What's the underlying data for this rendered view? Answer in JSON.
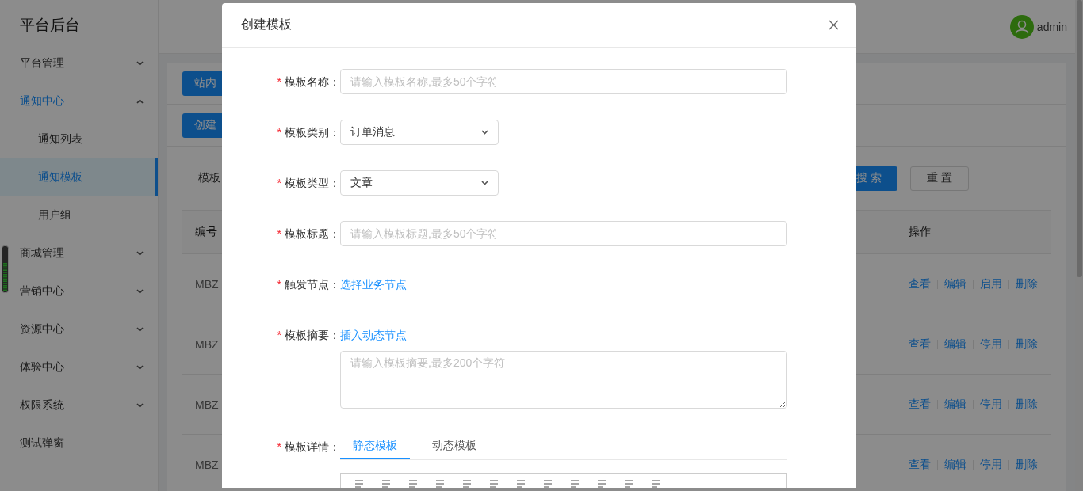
{
  "app": {
    "title": "平台后台"
  },
  "sidebar": {
    "items": [
      {
        "kind": "group",
        "label": "平台管理",
        "expanded": false
      },
      {
        "kind": "group",
        "label": "通知中心",
        "expanded": true,
        "children": [
          {
            "label": "通知列表",
            "selected": false
          },
          {
            "label": "通知模板",
            "selected": true
          },
          {
            "label": "用户组",
            "selected": false
          }
        ]
      },
      {
        "kind": "group",
        "label": "商城管理",
        "expanded": false
      },
      {
        "kind": "group",
        "label": "营销中心",
        "expanded": false
      },
      {
        "kind": "group",
        "label": "资源中心",
        "expanded": false
      },
      {
        "kind": "group",
        "label": "体验中心",
        "expanded": false
      },
      {
        "kind": "group",
        "label": "权限系统",
        "expanded": false
      },
      {
        "kind": "link",
        "label": "测试弹窗"
      }
    ]
  },
  "header": {
    "user": "admin"
  },
  "page": {
    "tab_button": "站内",
    "create_button": "创建",
    "filter_label": "模板",
    "search_button": "搜索",
    "reset_button": "重置"
  },
  "table": {
    "columns": [
      "编号",
      "操作"
    ],
    "rows": [
      {
        "id": "MBZ",
        "actions": [
          "查看",
          "编辑",
          "启用",
          "删除"
        ]
      },
      {
        "id": "MBZ",
        "actions": [
          "查看",
          "编辑",
          "停用",
          "删除"
        ]
      },
      {
        "id": "MBZ",
        "actions": [
          "查看",
          "编辑",
          "停用",
          "删除"
        ]
      },
      {
        "id": "MBZ",
        "actions": [
          "查看",
          "编辑",
          "停用",
          "删除"
        ]
      }
    ]
  },
  "dialog": {
    "title": "创建模板",
    "fields": [
      {
        "kind": "input",
        "marker": "*",
        "label": "模板名称：",
        "placeholder": "请输入模板名称,最多50个字符"
      },
      {
        "kind": "select",
        "marker": "*",
        "label": "模板类别：",
        "value": "订单消息"
      },
      {
        "kind": "select",
        "marker": "*",
        "label": "模板类型：",
        "value": "文章"
      },
      {
        "kind": "input",
        "marker": "*",
        "label": "模板标题：",
        "placeholder": "请输入模板标题,最多50个字符"
      },
      {
        "kind": "link",
        "marker": "*",
        "label": "触发节点：",
        "link": "选择业务节点"
      },
      {
        "kind": "textarea",
        "marker": "*",
        "label": "模板摘要：",
        "link": "插入动态节点",
        "placeholder": "请输入模板摘要,最多200个字符"
      },
      {
        "kind": "tabs",
        "marker": "*",
        "label": "模板详情：",
        "tabs": [
          {
            "label": "静态模板",
            "selected": true
          },
          {
            "label": "动态模板",
            "selected": false
          }
        ]
      }
    ]
  }
}
